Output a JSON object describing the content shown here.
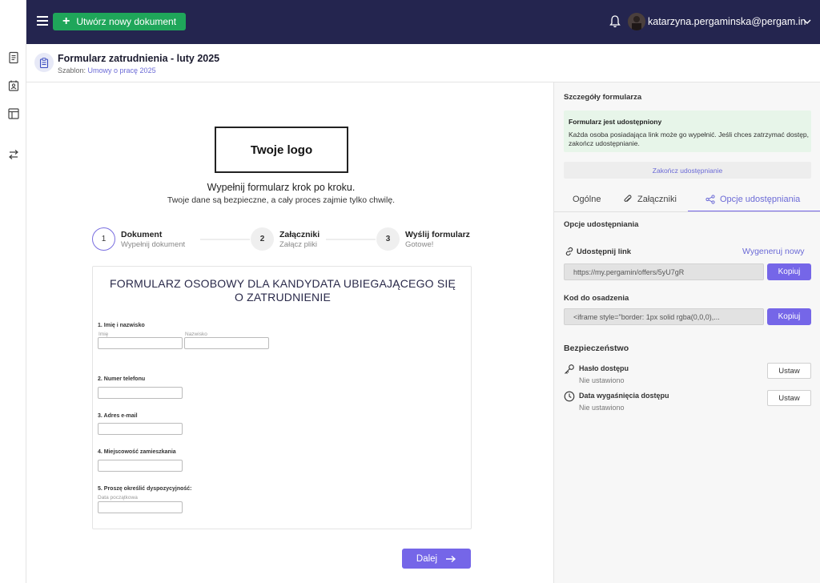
{
  "topbar": {
    "new_doc_label": "Utwórz nowy dokument",
    "user_email": "katarzyna.pergaminska@pergam.in"
  },
  "doc": {
    "title": "Formularz zatrudnienia - luty 2025",
    "template_prefix": "Szablon: ",
    "template_name": "Umowy o pracę 2025"
  },
  "main": {
    "logo_placeholder": "Twoje logo",
    "intro_line1": "Wypełnij formularz krok po kroku.",
    "intro_line2": "Twoje dane są bezpieczne, a cały proces zajmie tylko chwilę.",
    "steps": [
      {
        "num": "1",
        "title": "Dokument",
        "sub": "Wypełnij dokument"
      },
      {
        "num": "2",
        "title": "Załączniki",
        "sub": "Załącz pliki"
      },
      {
        "num": "3",
        "title": "Wyślij formularz",
        "sub": "Gotowe!"
      }
    ],
    "form": {
      "title_line1": "FORMULARZ OSOBOWY DLA KANDYDATA UBIEGAJĄCEGO SIĘ",
      "title_line2": "O ZATRUDNIENIE",
      "q1": "1. Imię i nazwisko",
      "q1_first": "Imię",
      "q1_last": "Nazwisko",
      "q2": "2. Numer telefonu",
      "q3": "3. Adres e-mail",
      "q4": "4. Miejscowość zamieszkania",
      "q5": "5. Proszę określić dyspozycyjność:",
      "q5_sub": "Data początkowa"
    },
    "next_label": "Dalej"
  },
  "panel": {
    "heading": "Szczegóły formularza",
    "shared_title": "Formularz jest udostępniony",
    "shared_desc": "Każda osoba posiadająca link może go wypełnić. Jeśli chces zatrzymać dostęp, zakończ udostępnianie.",
    "stop_share": "Zakończ udostępnianie",
    "tabs": [
      "Ogólne",
      "Załączniki",
      "Opcje udostępniania"
    ],
    "sharing_title": "Opcje udostępniania",
    "share_link_label": "Udostępnij link",
    "regenerate": "Wygeneruj nowy",
    "share_url": "https://my.pergamin/offers/5yU7gR",
    "copy": "Kopiuj",
    "embed_label": "Kod do osadzenia",
    "embed_code": "<iframe style=\"border: 1px solid rgba(0,0,0),...",
    "security_title": "Bezpieczeństwo",
    "password_label": "Hasło dostępu",
    "password_status": "Nie ustawiono",
    "expiry_label": "Data wygaśnięcia dostępu",
    "expiry_status": "Nie ustawiono",
    "set": "Ustaw"
  },
  "colors": {
    "topbar": "#24254f",
    "accent": "#7566e8",
    "green": "#1fa65a"
  }
}
